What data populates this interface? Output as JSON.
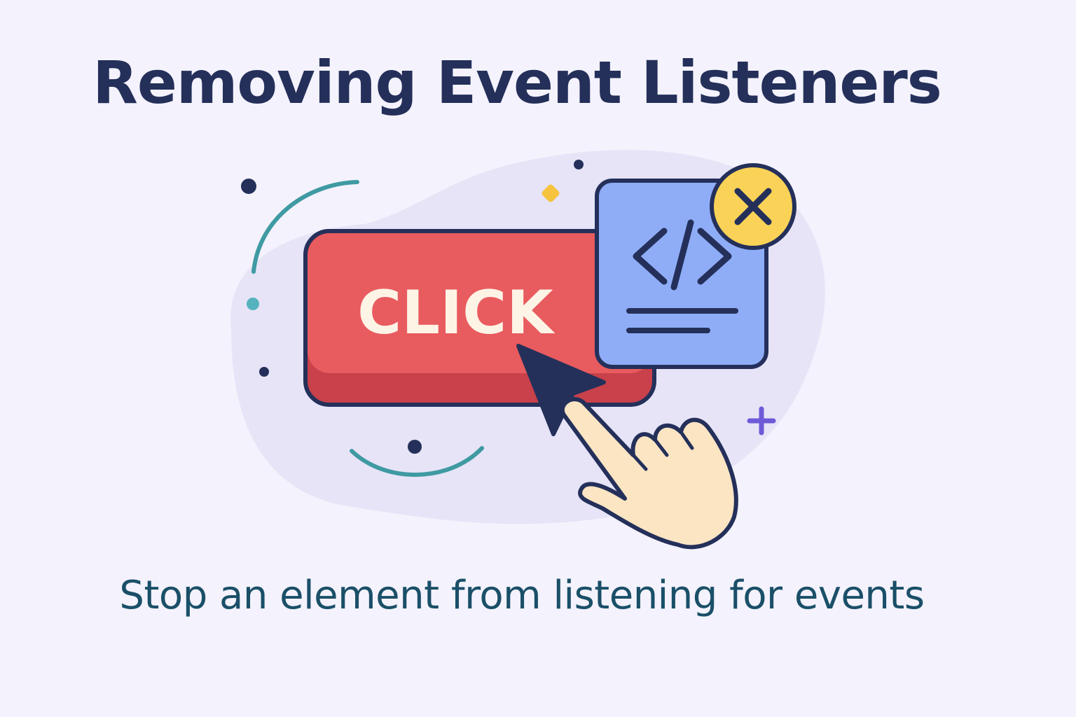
{
  "title": "Removing Event Listeners",
  "subtitle": "Stop an element from listening for events",
  "button": {
    "label": "CLICK"
  },
  "icons": {
    "code": "code-brackets-icon",
    "remove": "close-x-icon",
    "cursor": "arrow-cursor-icon",
    "hand": "pointing-hand-icon"
  },
  "colors": {
    "title": "#24305a",
    "subtitle": "#1a4f68",
    "button": "#e85b5f",
    "code_card": "#8fadf7",
    "remove_badge": "#f9d257",
    "background_blob": "#e7e4f8"
  }
}
